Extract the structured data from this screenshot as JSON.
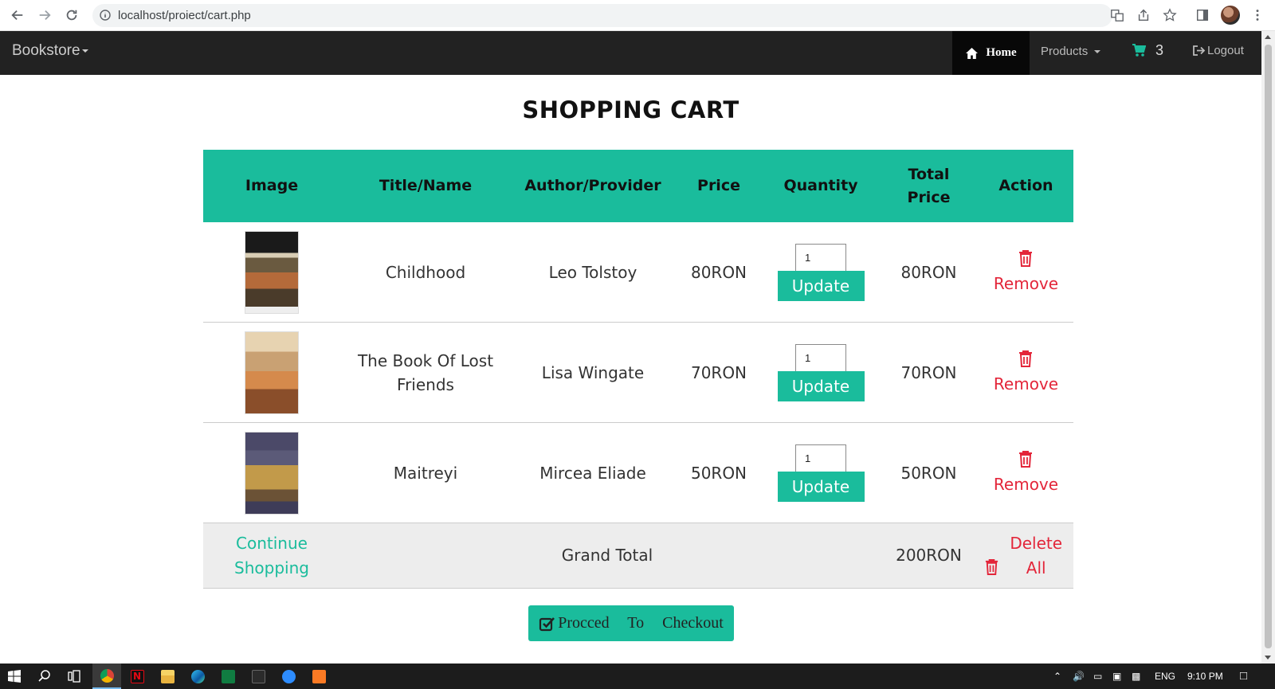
{
  "browser": {
    "url": "localhost/proiect/cart.php"
  },
  "navbar": {
    "brand": "Bookstore",
    "home": "Home",
    "products": "Products",
    "cart_count": "3",
    "logout": "Logout"
  },
  "page": {
    "title": "SHOPPING CART"
  },
  "table": {
    "headers": {
      "image": "Image",
      "title": "Title/Name",
      "author": "Author/Provider",
      "price": "Price",
      "quantity": "Quantity",
      "total": "Total Price",
      "action": "Action"
    },
    "rows": [
      {
        "title": "Childhood",
        "author": "Leo Tolstoy",
        "price": "80RON",
        "quantity": "1",
        "total": "80RON",
        "update": "Update",
        "remove": "Remove"
      },
      {
        "title": "The Book Of Lost Friends",
        "author": "Lisa Wingate",
        "price": "70RON",
        "quantity": "1",
        "total": "70RON",
        "update": "Update",
        "remove": "Remove"
      },
      {
        "title": "Maitreyi",
        "author": "Mircea Eliade",
        "price": "50RON",
        "quantity": "1",
        "total": "50RON",
        "update": "Update",
        "remove": "Remove"
      }
    ],
    "footer": {
      "continue": "Continue Shopping",
      "grand_total_label": "Grand Total",
      "grand_total_value": "200RON",
      "delete_all": "Delete All"
    }
  },
  "checkout": {
    "label": "Procced To Checkout"
  },
  "taskbar": {
    "language": "ENG",
    "time": "9:10 PM"
  },
  "colors": {
    "accent": "#1abc9c",
    "danger": "#e3263a",
    "navbar": "#222222"
  }
}
